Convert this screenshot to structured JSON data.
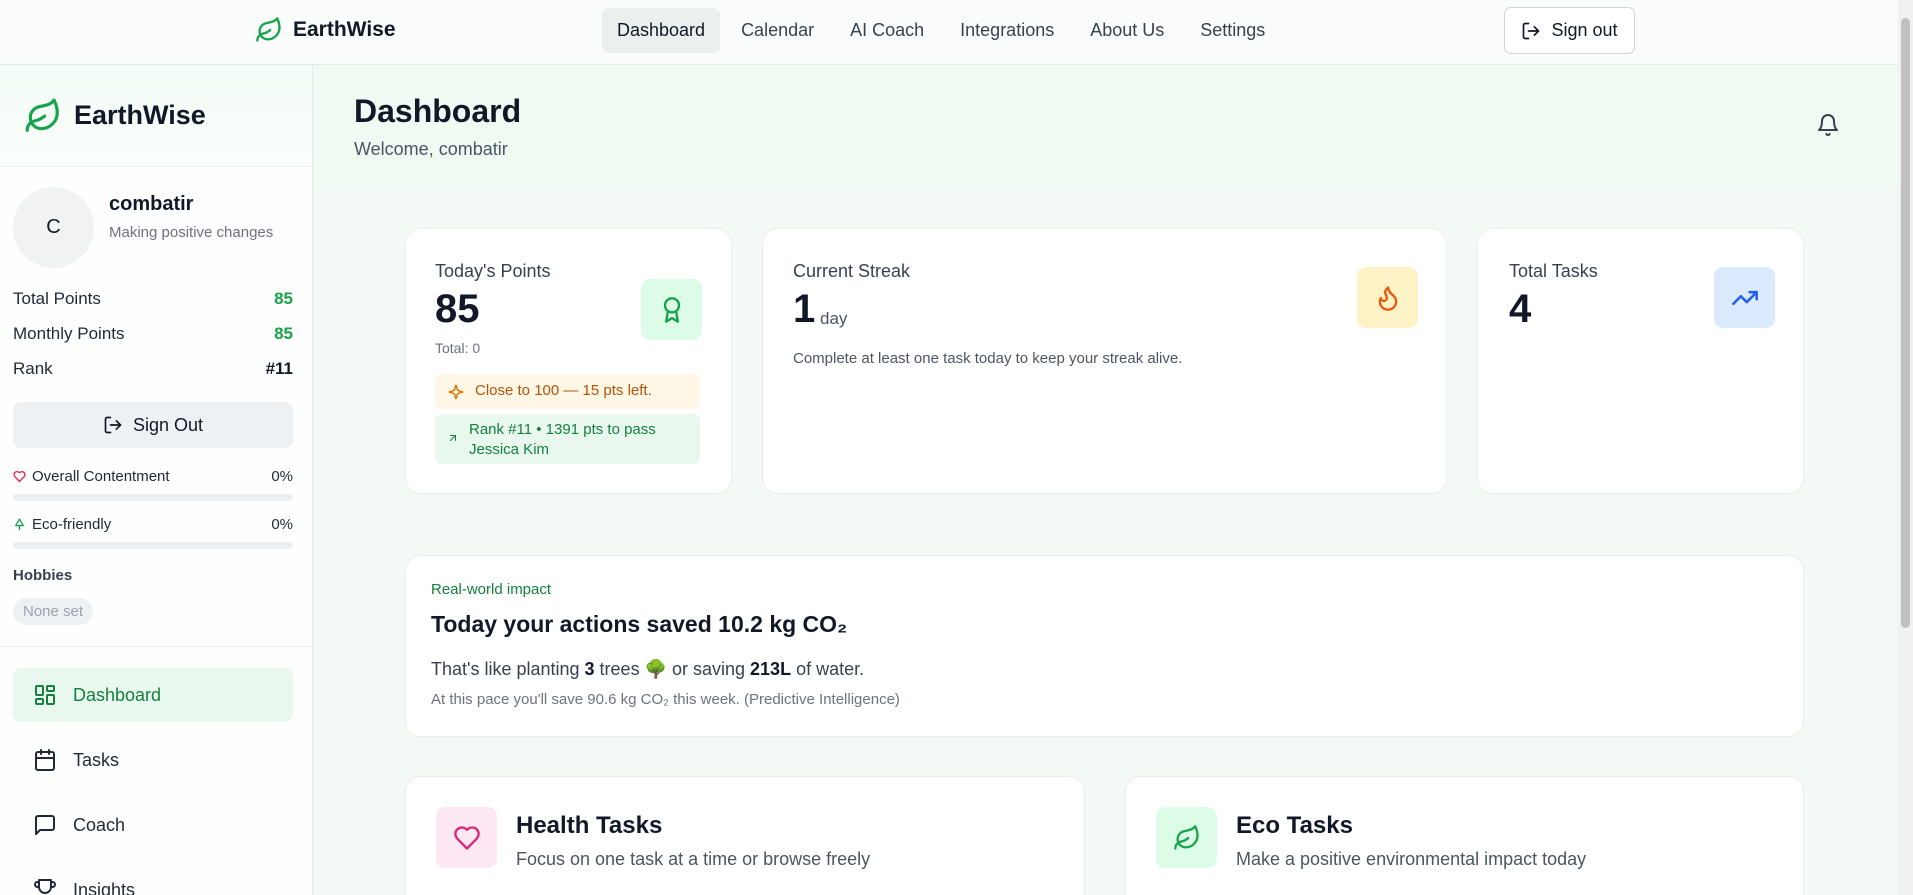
{
  "topnav": {
    "brand": "EarthWise",
    "links": [
      "Dashboard",
      "Calendar",
      "AI Coach",
      "Integrations",
      "About Us",
      "Settings"
    ],
    "active_link": "Dashboard",
    "sign_out": "Sign out"
  },
  "sidebar": {
    "brand": "EarthWise",
    "profile": {
      "initial": "C",
      "name": "combatir",
      "tagline": "Making positive changes"
    },
    "stats": [
      {
        "label": "Total Points",
        "value": "85"
      },
      {
        "label": "Monthly Points",
        "value": "85"
      },
      {
        "label": "Rank",
        "value": "#11"
      }
    ],
    "sign_out": "Sign Out",
    "meters": [
      {
        "label": "Overall Contentment",
        "value": "0%",
        "fraction": 0,
        "icon": "heart-icon"
      },
      {
        "label": "Eco-friendly",
        "value": "0%",
        "fraction": 0,
        "icon": "tree-icon"
      }
    ],
    "hobbies_title": "Hobbies",
    "hobbies_empty": "None set",
    "nav": [
      {
        "label": "Dashboard",
        "icon": "dashboard-icon",
        "active": true
      },
      {
        "label": "Tasks",
        "icon": "calendar-icon"
      },
      {
        "label": "Coach",
        "icon": "chat-icon"
      },
      {
        "label": "Insights",
        "icon": "trophy-icon"
      }
    ]
  },
  "header": {
    "title": "Dashboard",
    "welcome": "Welcome, combatir"
  },
  "cards": {
    "points": {
      "title": "Today's Points",
      "value": "85",
      "total": "Total: 0",
      "milestone": "Close to 100 — 15 pts left.",
      "rank_note": "Rank #11 • 1391 pts to pass Jessica Kim",
      "icon": "award-icon"
    },
    "streak": {
      "title": "Current Streak",
      "value": "1",
      "unit": "day",
      "hint": "Complete at least one task today to keep your streak alive.",
      "icon": "flame-icon"
    },
    "tasks": {
      "title": "Total Tasks",
      "value": "4",
      "icon": "trending-up-icon"
    }
  },
  "impact": {
    "kicker": "Real-world impact",
    "title": "Today your actions saved 10.2 kg CO₂",
    "line_prefix": "That's like planting ",
    "trees": "3",
    "line_mid": " trees 🌳 or saving ",
    "water": "213L",
    "line_suffix": " of water.",
    "prediction": "At this pace you'll save 90.6 kg CO₂ this week. (Predictive Intelligence)"
  },
  "task_sections": [
    {
      "title": "Health Tasks",
      "subtitle": "Focus on one task at a time or browse freely",
      "icon": "heart-icon",
      "color": "#db2777",
      "bg": "#fce7f3"
    },
    {
      "title": "Eco Tasks",
      "subtitle": "Make a positive environmental impact today",
      "icon": "leaf-icon",
      "color": "#16a34a",
      "bg": "#dcfce7"
    }
  ],
  "colors": {
    "accent": "#16a34a",
    "accent_bg": "#e8f8ee"
  }
}
